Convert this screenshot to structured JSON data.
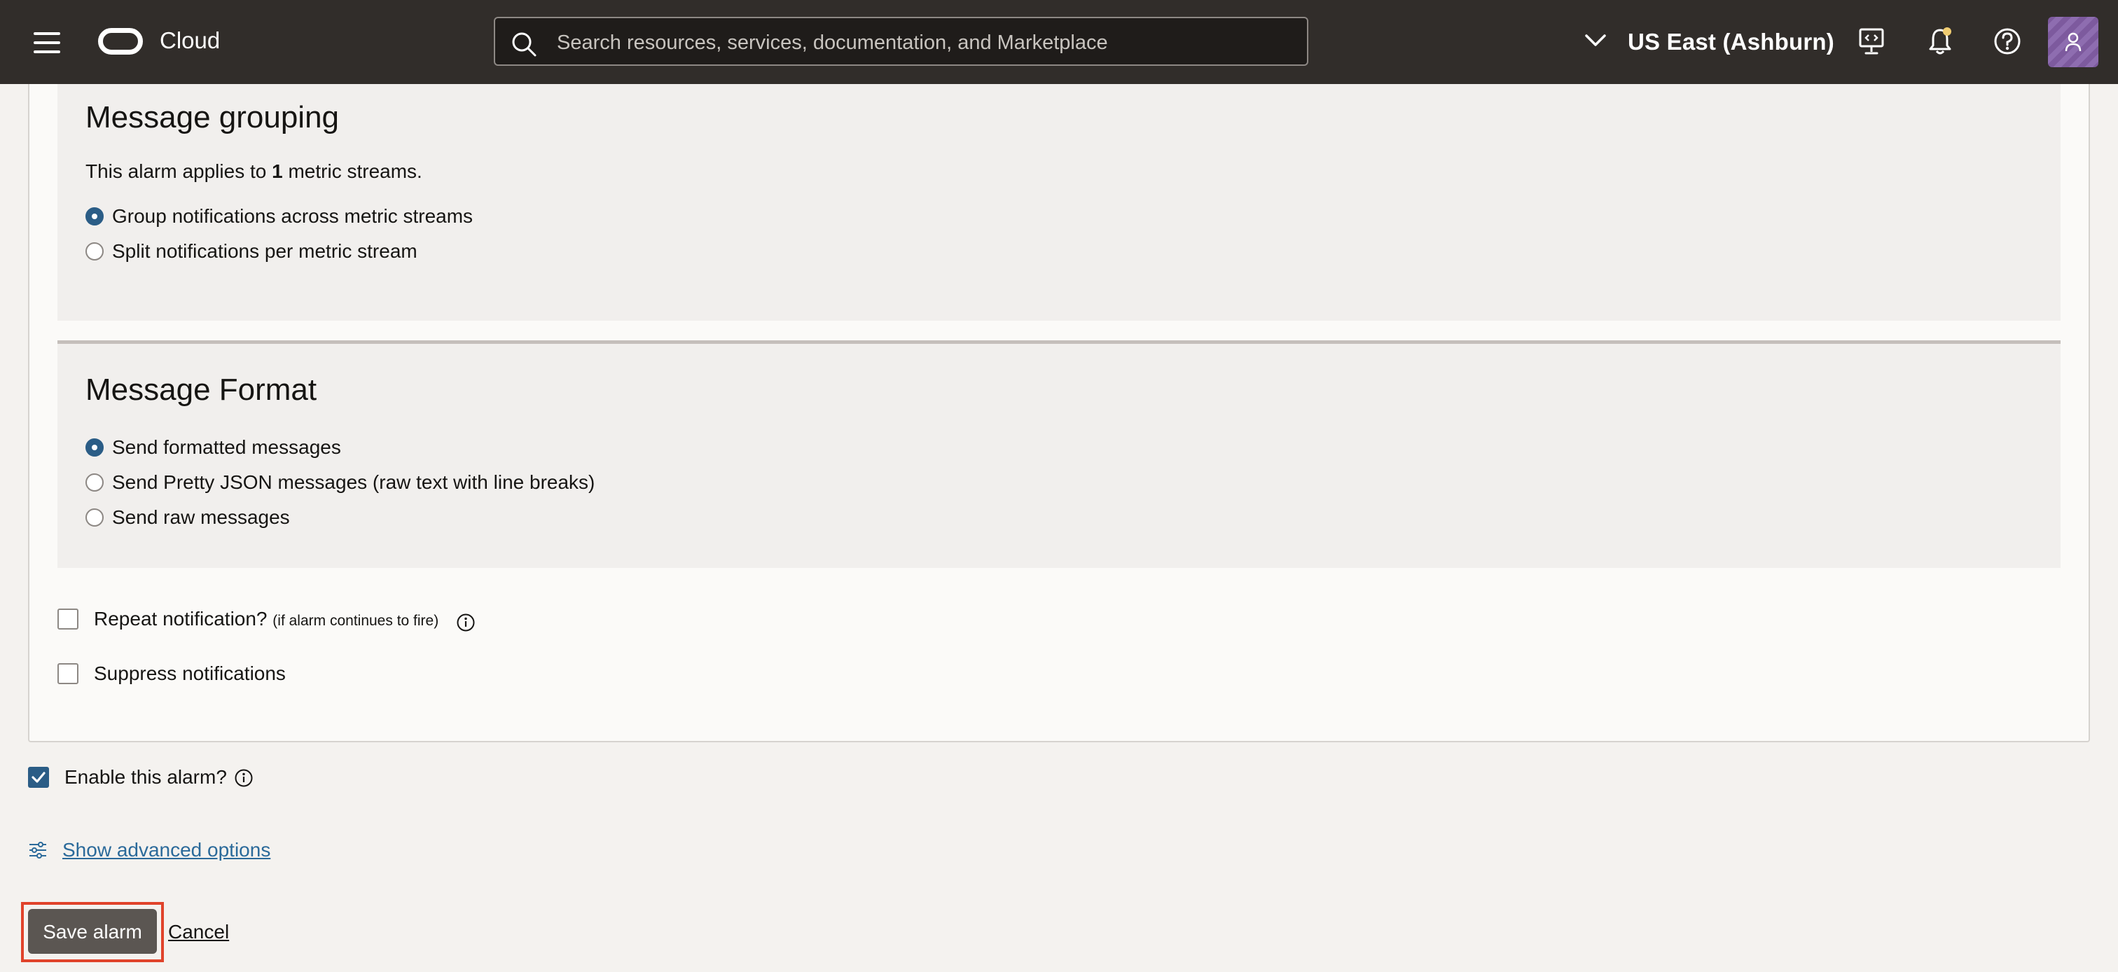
{
  "header": {
    "brand": "Cloud",
    "search_placeholder": "Search resources, services, documentation, and Marketplace",
    "region": "US East (Ashburn)"
  },
  "message_grouping": {
    "title": "Message grouping",
    "applies_prefix": "This alarm applies to ",
    "applies_count": "1",
    "applies_suffix": " metric streams.",
    "options": [
      {
        "label": "Group notifications across metric streams",
        "selected": true
      },
      {
        "label": "Split notifications per metric stream",
        "selected": false
      }
    ]
  },
  "message_format": {
    "title": "Message Format",
    "options": [
      {
        "label": "Send formatted messages",
        "selected": true
      },
      {
        "label": "Send Pretty JSON messages (raw text with line breaks)",
        "selected": false
      },
      {
        "label": "Send raw messages",
        "selected": false
      }
    ]
  },
  "repeat_notification": {
    "label": "Repeat notification?",
    "hint": "(if alarm continues to fire)",
    "checked": false
  },
  "suppress_notifications": {
    "label": "Suppress notifications",
    "checked": false
  },
  "enable_alarm": {
    "label": "Enable this alarm?",
    "checked": true
  },
  "advanced_link": "Show advanced options",
  "actions": {
    "save": "Save alarm",
    "cancel": "Cancel"
  },
  "colors": {
    "topbar": "#312d2a",
    "accent": "#2b5d86",
    "link": "#2b6a9a",
    "highlight": "#e0432b"
  }
}
